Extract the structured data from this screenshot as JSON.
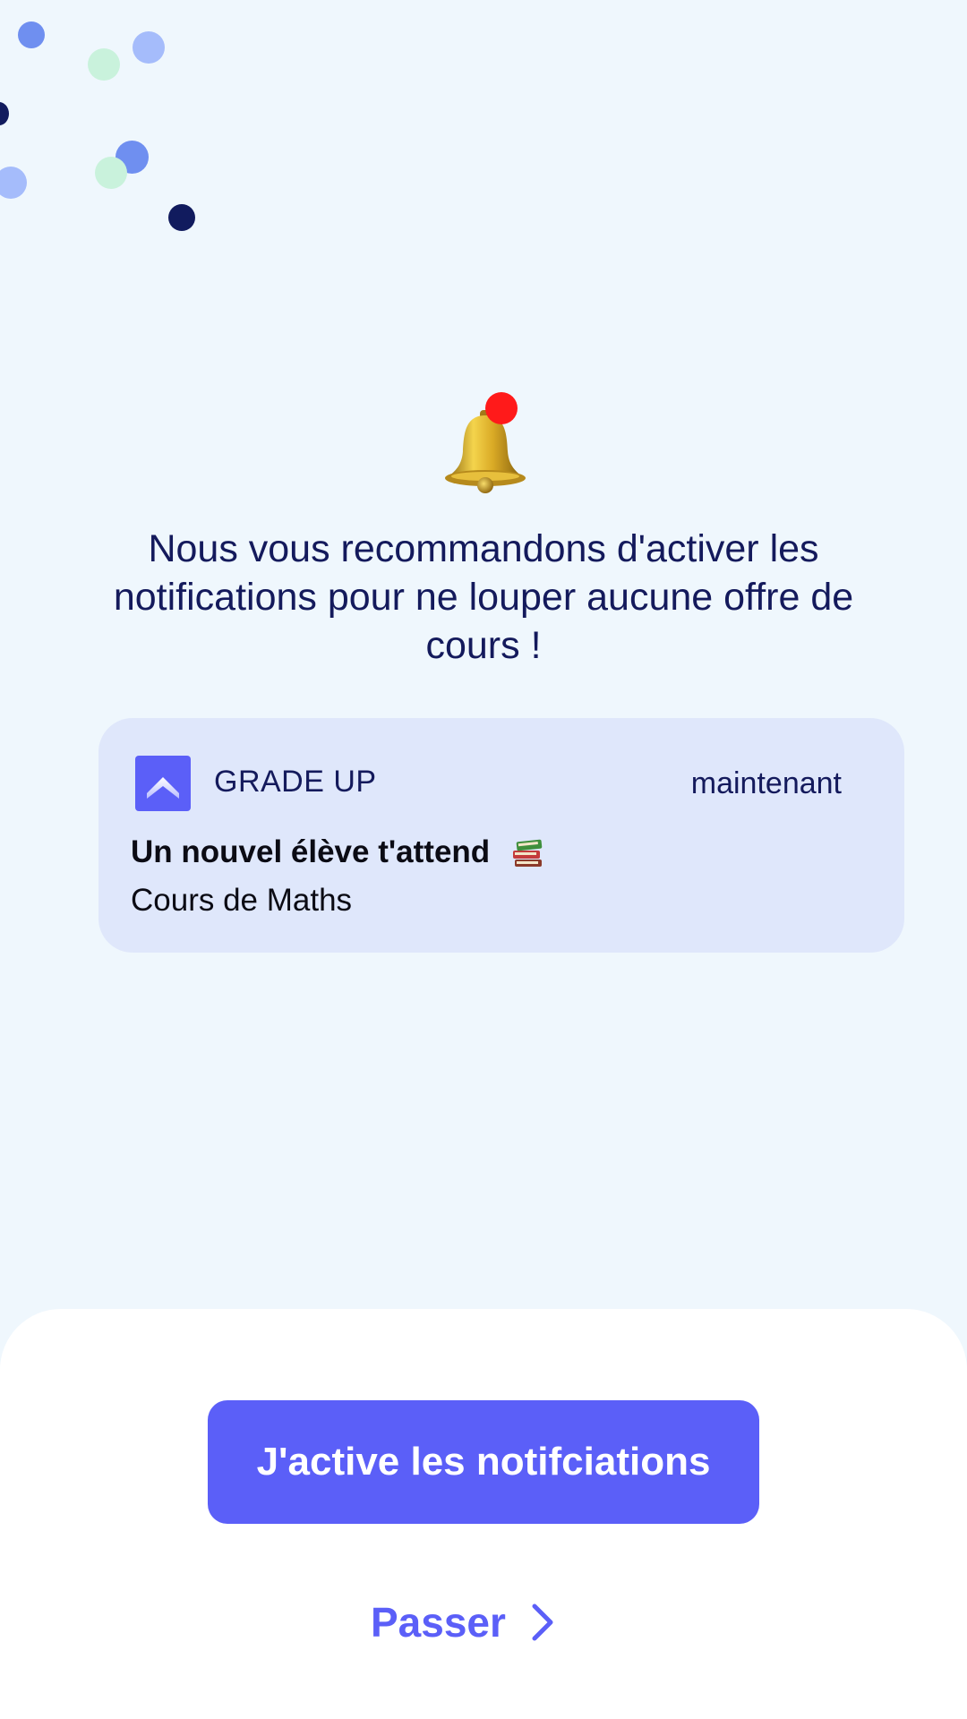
{
  "colors": {
    "background": "#eff7fd",
    "primary": "#5b5ff8",
    "text_dark": "#141a5c",
    "card_background": "#dfe7fb",
    "sheet_background": "#ffffff",
    "badge_red": "#ff1a1a"
  },
  "icons": {
    "bell": "bell-icon",
    "app": "grade-up-logo-icon",
    "books_emoji": "books-emoji-icon",
    "chevron": "chevron-right-icon"
  },
  "headline": "Nous vous recommandons d'activer les notifications pour ne louper aucune offre de cours !",
  "notification": {
    "app_name": "GRADE UP",
    "time": "maintenant",
    "title": "Un nouvel élève t'attend",
    "body": "Cours de Maths"
  },
  "actions": {
    "enable_label": "J'active les notifciations",
    "skip_label": "Passer"
  }
}
